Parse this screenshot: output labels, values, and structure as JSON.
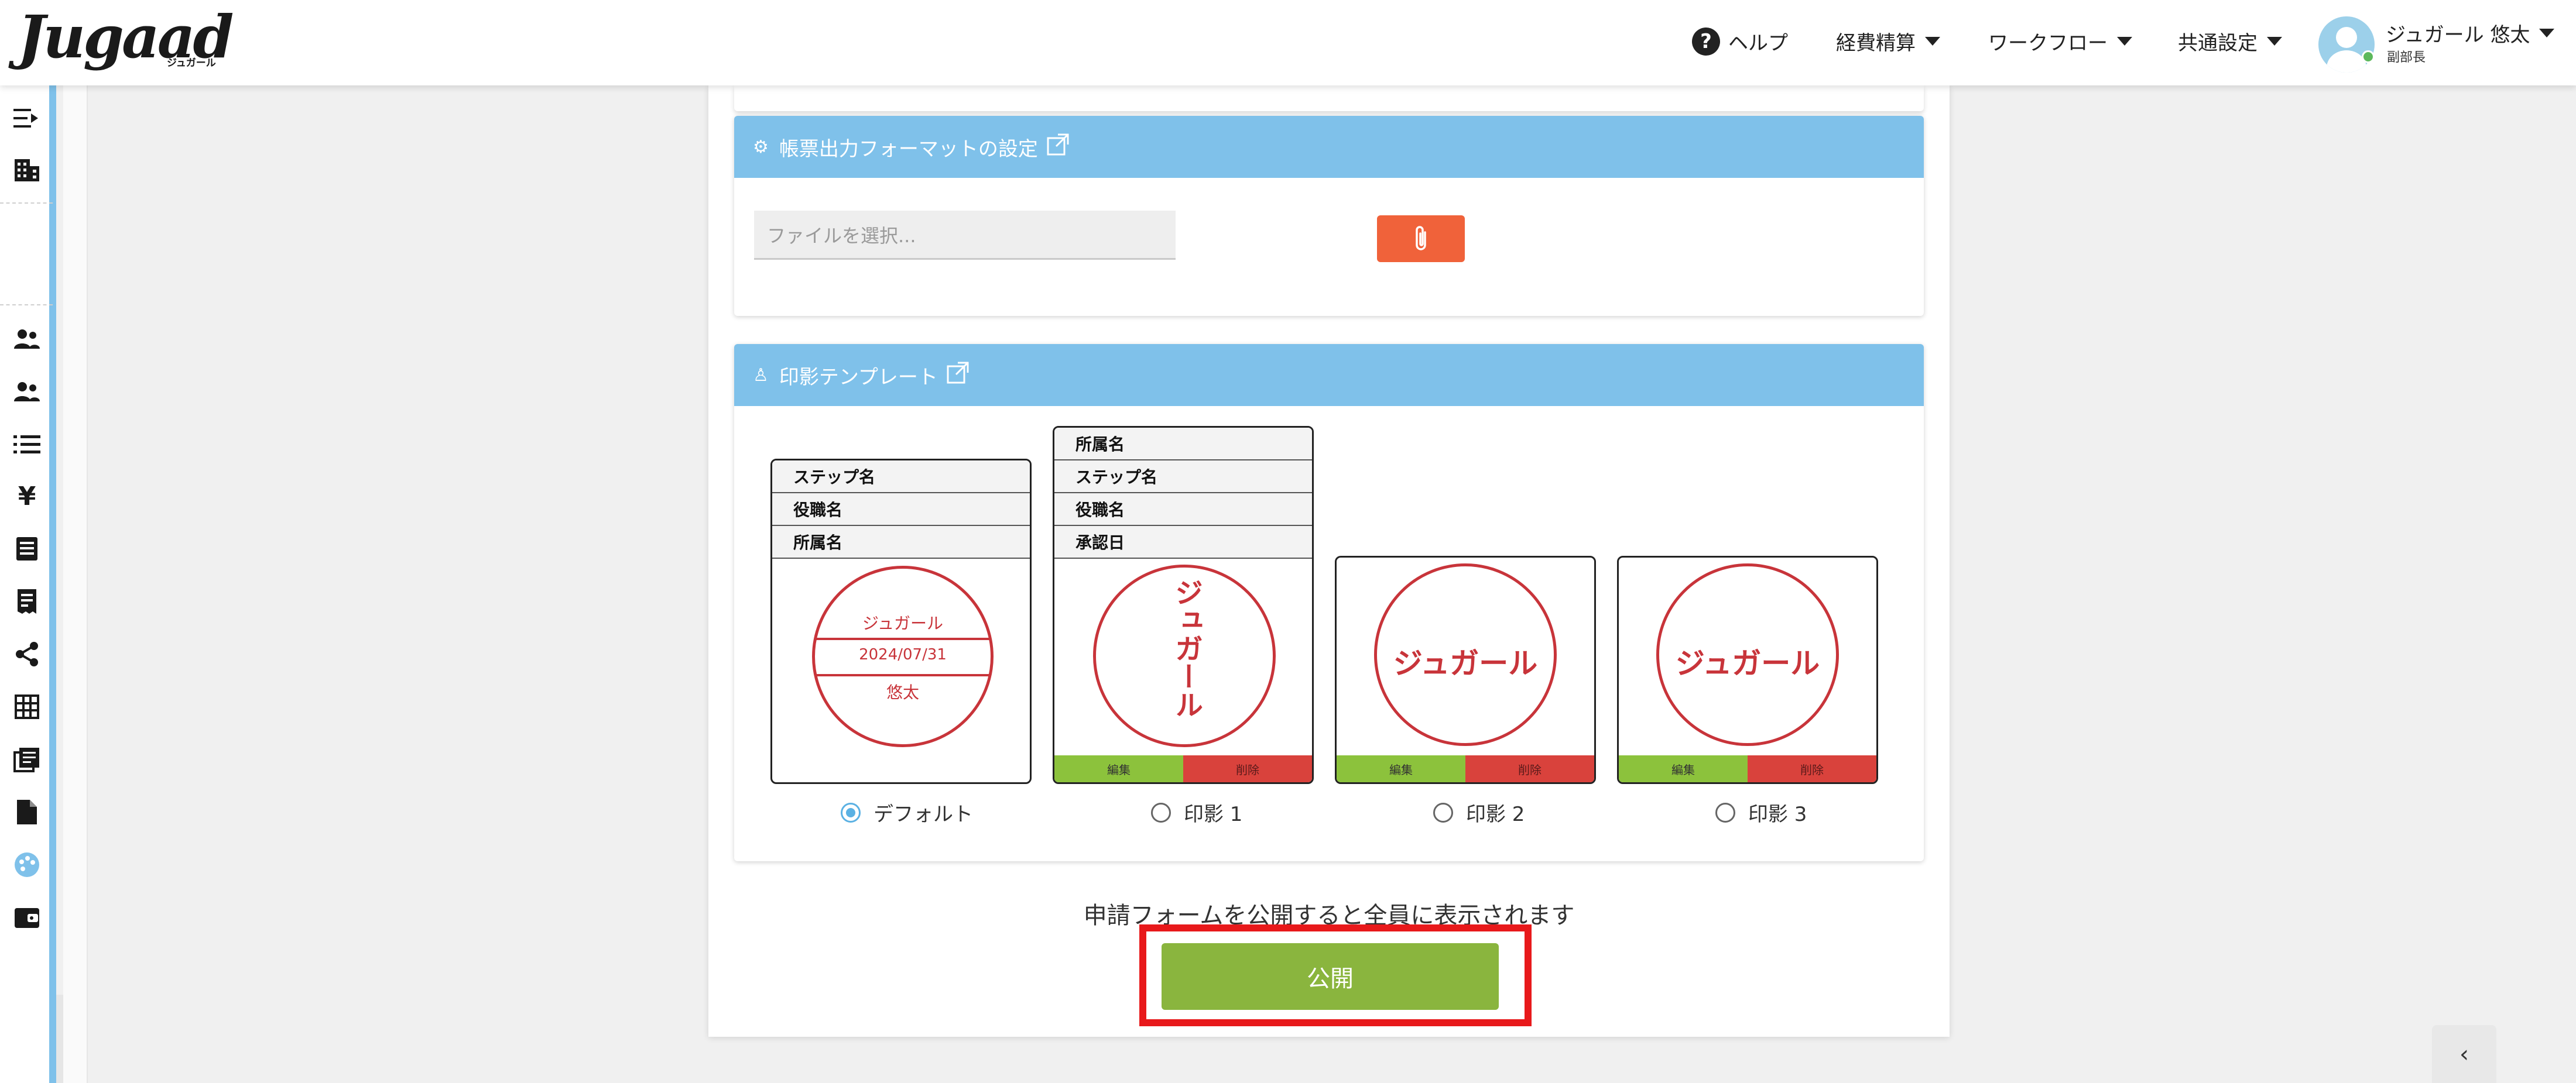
{
  "header": {
    "logo": "Jugaad",
    "logo_sub": "ジュガール",
    "help": "ヘルプ",
    "nav": [
      "経費精算",
      "ワークフロー",
      "共通設定"
    ],
    "user_name": "ジュガール 悠太",
    "user_role": "副部長"
  },
  "sidebar": {
    "icons": [
      "collapse-icon",
      "building-icon",
      "users-icon",
      "users-group-icon",
      "list-icon",
      "yen-icon",
      "document-list-icon",
      "receipt-icon",
      "share-icon",
      "table-icon",
      "library-icon",
      "file-icon",
      "palette-icon",
      "wallet-icon"
    ],
    "accent": "#7fc1ea"
  },
  "format_card": {
    "title": "帳票出力フォーマットの設定",
    "file_placeholder": "ファイルを選択..."
  },
  "stamp_card": {
    "title": "印影テンプレート",
    "templates": [
      {
        "rows": [
          "ステップ名",
          "役職名",
          "所属名"
        ],
        "seal": [
          "ジュガール",
          "2024/07/31",
          "悠太"
        ],
        "option": "デフォルト"
      },
      {
        "rows": [
          "所属名",
          "ステップ名",
          "役職名",
          "承認日"
        ],
        "seal": [
          "ジュガール"
        ],
        "option": "印影 1",
        "edit": "編集",
        "delete": "削除"
      },
      {
        "seal": [
          "ジュガール"
        ],
        "option": "印影 2",
        "edit": "編集",
        "delete": "削除"
      },
      {
        "seal": [
          "ジュガール"
        ],
        "option": "印影 3",
        "edit": "編集",
        "delete": "削除"
      }
    ],
    "selected": "デフォルト"
  },
  "publish": {
    "note": "申請フォームを公開すると全員に表示されます",
    "button": "公開"
  },
  "colors": {
    "header_bar": "#7fc1ea",
    "seal": "#c8343a",
    "publish": "#8ab53e",
    "attach": "#f0623a",
    "highlight": "#e8191b"
  },
  "scroll_top": "‹"
}
